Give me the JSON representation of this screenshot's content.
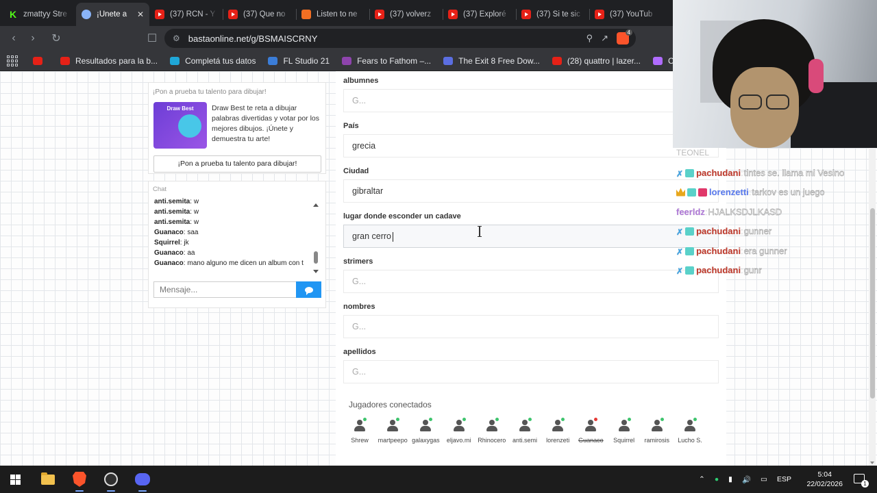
{
  "browser": {
    "tabs": [
      {
        "title": "zmattyy Stre",
        "icon": "kick-icon",
        "active": false
      },
      {
        "title": "¡Únete a",
        "icon": "basta-icon",
        "active": true
      },
      {
        "title": "(37) RCN - Y",
        "icon": "youtube-icon",
        "active": false
      },
      {
        "title": "(37) Que no",
        "icon": "youtube-icon",
        "active": false
      },
      {
        "title": "Listen to ne",
        "icon": "soundcloud-icon",
        "active": false
      },
      {
        "title": "(37) volverz",
        "icon": "youtube-icon",
        "active": false
      },
      {
        "title": "(37) Exploré",
        "icon": "youtube-icon",
        "active": false
      },
      {
        "title": "(37) Si te sic",
        "icon": "youtube-icon",
        "active": false
      },
      {
        "title": "(37) YouTub",
        "icon": "youtube-icon",
        "active": false
      }
    ],
    "url": "bastaonline.net/g/BSMAISCRNY",
    "bookmarks": [
      {
        "label": "Resultados para la b...",
        "color": "#e62117"
      },
      {
        "label": "Completá tus datos",
        "color": "#1fa7d8"
      },
      {
        "label": "FL Studio 21",
        "color": "#3b7dd8"
      },
      {
        "label": "Fears to Fathom –...",
        "color": "#8e44ad"
      },
      {
        "label": "The Exit 8 Free Dow...",
        "color": "#5b6ee1"
      },
      {
        "label": "(28) quattro | lazer...",
        "color": "#e62117"
      },
      {
        "label": "Captura de p",
        "color": "#b06cff"
      }
    ]
  },
  "promo": {
    "heading": "¡Pon a prueba tu talento para dibujar!",
    "thumb_title": "Draw Best",
    "description": "Draw Best te reta a dibujar palabras divertidas y votar por los mejores dibujos. ¡Únete y demuestra tu arte!",
    "button": "¡Pon a prueba tu talento para dibujar!"
  },
  "chat": {
    "title": "Chat",
    "messages": [
      {
        "user": "anti.semita",
        "text": "w"
      },
      {
        "user": "anti.semita",
        "text": "w"
      },
      {
        "user": "anti.semita",
        "text": "w"
      },
      {
        "user": "Guanaco",
        "text": "saa"
      },
      {
        "user": "Squirrel",
        "text": "jk"
      },
      {
        "user": "Guanaco",
        "text": "aa"
      },
      {
        "user": "Guanaco",
        "text": "mano alguno me dicen un album con t"
      }
    ],
    "input_placeholder": "Mensaje..."
  },
  "form": {
    "fields": [
      {
        "label": "albumnes",
        "value": "",
        "placeholder": "G..."
      },
      {
        "label": "País",
        "value": "grecia",
        "placeholder": "G..."
      },
      {
        "label": "Ciudad",
        "value": "gibraltar",
        "placeholder": "G..."
      },
      {
        "label": "lugar donde esconder un cadave",
        "value": "gran cerro",
        "placeholder": "G...",
        "focused": true
      },
      {
        "label": "strimers",
        "value": "",
        "placeholder": "G..."
      },
      {
        "label": "nombres",
        "value": "",
        "placeholder": "G..."
      },
      {
        "label": "apellidos",
        "value": "",
        "placeholder": "G..."
      }
    ]
  },
  "players": {
    "title": "Jugadores conectados",
    "list": [
      {
        "name": "Shrew",
        "status": "online"
      },
      {
        "name": "martpeepo",
        "status": "online"
      },
      {
        "name": "galaxygas",
        "status": "online"
      },
      {
        "name": "eljavo.mi",
        "status": "online"
      },
      {
        "name": "Rhinocero",
        "status": "online"
      },
      {
        "name": "anti.semi",
        "status": "online"
      },
      {
        "name": "lorenzeti",
        "status": "online"
      },
      {
        "name": "Guanaco",
        "status": "offline"
      },
      {
        "name": "Squirrel",
        "status": "online"
      },
      {
        "name": "ramirosis",
        "status": "online"
      },
      {
        "name": "Lucho S.",
        "status": "online"
      }
    ]
  },
  "stream_chat": {
    "faded_top": "TEONEL",
    "lines": [
      {
        "badges": [
          "sword",
          "cyan"
        ],
        "user": "pachudani",
        "user_color": "#c0392b",
        "text": "tintes se. llama mi Vesino"
      },
      {
        "badges": [
          "crown",
          "cyan",
          "pink"
        ],
        "user": "lorenzetti",
        "user_color": "#5b7cf0",
        "text": "tarkov es un juego"
      },
      {
        "badges": [],
        "user": "feerldz",
        "user_color": "#b07ad8",
        "text": "HJALKSDJLKASD"
      },
      {
        "badges": [
          "sword",
          "cyan"
        ],
        "user": "pachudani",
        "user_color": "#c0392b",
        "text": "gunner"
      },
      {
        "badges": [
          "sword",
          "cyan"
        ],
        "user": "pachudani",
        "user_color": "#c0392b",
        "text": "era gunner"
      },
      {
        "badges": [
          "sword",
          "cyan"
        ],
        "user": "pachudani",
        "user_color": "#c0392b",
        "text": "gunr"
      }
    ]
  },
  "taskbar": {
    "language": "ESP",
    "time": "5:04",
    "date": "22/02/2026",
    "notifications": "1"
  }
}
